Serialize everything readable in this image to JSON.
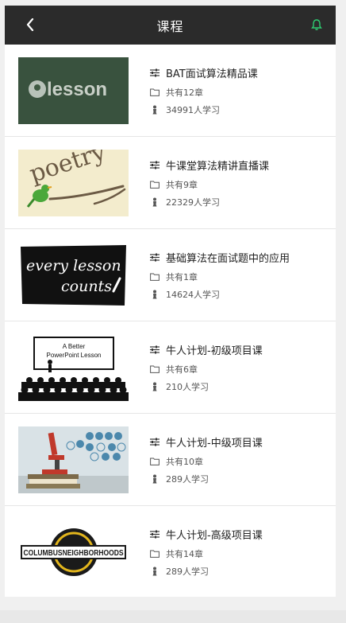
{
  "header": {
    "title": "课程"
  },
  "colors": {
    "header_bg": "#2b2b2b",
    "bell_accent": "#2ecc71"
  },
  "icons": {
    "back": "chevron-left-icon",
    "bell": "bell-icon",
    "title": "sliders-icon",
    "chapters": "folder-icon",
    "learners": "person-icon"
  },
  "courses": [
    {
      "title": "BAT面试算法精品课",
      "chapters": "共有12章",
      "learners": "34991人学习",
      "thumb_text": "lesson"
    },
    {
      "title": "牛课堂算法精讲直播课",
      "chapters": "共有9章",
      "learners": "22329人学习",
      "thumb_text": "poetry"
    },
    {
      "title": "基础算法在面试题中的应用",
      "chapters": "共有1章",
      "learners": "14624人学习",
      "thumb_text_1": "every lesson",
      "thumb_text_2": "counts"
    },
    {
      "title": "牛人计划-初级项目课",
      "chapters": "共有6章",
      "learners": "210人学习",
      "thumb_text_1": "A Better",
      "thumb_text_2": "PowerPoint Lesson"
    },
    {
      "title": "牛人计划-中级项目课",
      "chapters": "共有10章",
      "learners": "289人学习"
    },
    {
      "title": "牛人计划-高级项目课",
      "chapters": "共有14章",
      "learners": "289人学习",
      "thumb_text": "COLUMBUSNEIGHBORHOODS"
    }
  ]
}
